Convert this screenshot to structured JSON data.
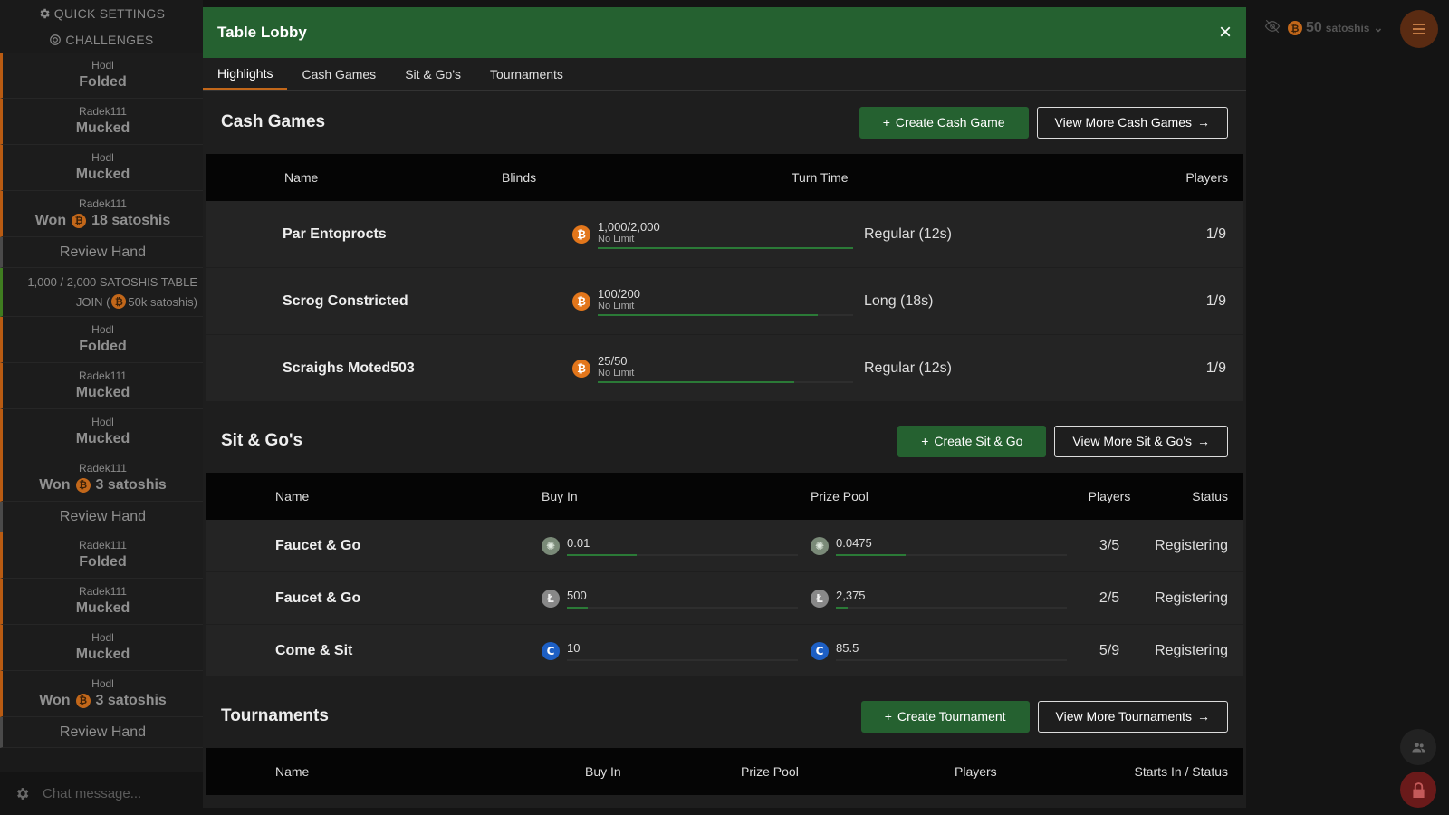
{
  "sidebar": {
    "quick_settings": "QUICK SETTINGS",
    "challenges": "CHALLENGES",
    "log": [
      {
        "type": "action",
        "who": "Hodl",
        "act": "Folded"
      },
      {
        "type": "action",
        "who": "Radek111",
        "act": "Mucked"
      },
      {
        "type": "action",
        "who": "Hodl",
        "act": "Mucked"
      },
      {
        "type": "won",
        "who": "Radek111",
        "act": "Won",
        "amount": "18 satoshis"
      },
      {
        "type": "review",
        "act": "Review Hand"
      },
      {
        "type": "table",
        "line1": "1,000 / 2,000 SATOSHIS TABLE",
        "line2_pre": "JOIN (",
        "line2_post": "50k satoshis)"
      },
      {
        "type": "action",
        "who": "Hodl",
        "act": "Folded"
      },
      {
        "type": "action",
        "who": "Radek111",
        "act": "Mucked"
      },
      {
        "type": "action",
        "who": "Hodl",
        "act": "Mucked"
      },
      {
        "type": "won",
        "who": "Radek111",
        "act": "Won",
        "amount": "3 satoshis"
      },
      {
        "type": "review",
        "act": "Review Hand"
      },
      {
        "type": "action",
        "who": "Radek111",
        "act": "Folded"
      },
      {
        "type": "action",
        "who": "Radek111",
        "act": "Mucked"
      },
      {
        "type": "action",
        "who": "Hodl",
        "act": "Mucked"
      },
      {
        "type": "won",
        "who": "Hodl",
        "act": "Won",
        "amount": "3 satoshis"
      },
      {
        "type": "review",
        "act": "Review Hand"
      }
    ],
    "chat_placeholder": "Chat message..."
  },
  "topbar": {
    "balance": "50",
    "unit": "satoshis"
  },
  "modal": {
    "title": "Table Lobby",
    "close": "×",
    "tabs": [
      "Highlights",
      "Cash Games",
      "Sit & Go's",
      "Tournaments"
    ],
    "active_tab": 0
  },
  "cash_games": {
    "title": "Cash Games",
    "create_label": "Create Cash Game",
    "more_label": "View More Cash Games",
    "headers": [
      "Name",
      "Blinds",
      "Turn Time",
      "Players"
    ],
    "rows": [
      {
        "name": "Par Entoprocts",
        "coin": "btc",
        "blinds": "1,000/2,000",
        "limit": "No Limit",
        "fill": 1.0,
        "turn": "Regular (12s)",
        "players": "1/9"
      },
      {
        "name": "Scrog Constricted",
        "coin": "btc",
        "blinds": "100/200",
        "limit": "No Limit",
        "fill": 0.86,
        "turn": "Long (18s)",
        "players": "1/9"
      },
      {
        "name": "Scraighs Moted503",
        "coin": "btc",
        "blinds": "25/50",
        "limit": "No Limit",
        "fill": 0.77,
        "turn": "Regular (12s)",
        "players": "1/9"
      }
    ]
  },
  "sit_and_go": {
    "title": "Sit & Go's",
    "create_label": "Create Sit & Go",
    "more_label": "View More Sit & Go's",
    "headers": [
      "Name",
      "Buy In",
      "Prize Pool",
      "Players",
      "Status"
    ],
    "rows": [
      {
        "name": "Faucet & Go",
        "coin": "faucet",
        "buyin": "0.01",
        "buyin_fill": 0.3,
        "prize": "0.0475",
        "prize_fill": 0.3,
        "players": "3/5",
        "status": "Registering"
      },
      {
        "name": "Faucet & Go",
        "coin": "ltc",
        "buyin": "500",
        "buyin_fill": 0.09,
        "prize": "2,375",
        "prize_fill": 0.05,
        "players": "2/5",
        "status": "Registering"
      },
      {
        "name": "Come & Sit",
        "coin": "ctc",
        "buyin": "10",
        "buyin_fill": 0.0,
        "prize": "85.5",
        "prize_fill": 0.0,
        "players": "5/9",
        "status": "Registering"
      }
    ]
  },
  "tournaments": {
    "title": "Tournaments",
    "create_label": "Create Tournament",
    "more_label": "View More Tournaments",
    "headers": [
      "Name",
      "Buy In",
      "Prize Pool",
      "Players",
      "Starts In / Status"
    ]
  },
  "colors": {
    "brand_green": "#256130",
    "accent_orange": "#c2671a",
    "btc": "#e2761b",
    "ctc": "#1d5fc4"
  },
  "icons": {
    "quick_settings": "gear-icon",
    "challenges": "target-icon",
    "close": "close-icon",
    "create": "plus-icon",
    "more": "arrow-right-icon",
    "menu": "hamburger-icon",
    "friends": "people-icon",
    "lock": "lock-icon",
    "visibility": "eye-off-icon"
  }
}
